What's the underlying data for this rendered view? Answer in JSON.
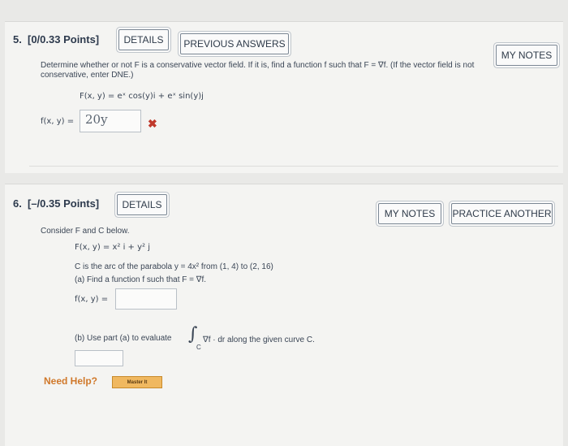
{
  "q5": {
    "number": "5.",
    "points": "[0/0.33 Points]",
    "details_label": "DETAILS",
    "previous_answers_label": "PREVIOUS ANSWERS",
    "my_notes_label": "MY NOTES",
    "prompt_line1": "Determine whether or not F is a conservative vector field. If it is, find a function f such that F = ∇f. (If the vector field is not",
    "prompt_line2": "conservative, enter DNE.)",
    "field": "F(x, y) = eˣ cos(y)i + eˣ sin(y)j",
    "f_label": "f(x, y) =",
    "answer": "20y",
    "incorrect_mark": "✖"
  },
  "q6": {
    "number": "6.",
    "points": "[–/0.35 Points]",
    "details_label": "DETAILS",
    "my_notes_label": "MY NOTES",
    "practice_label": "PRACTICE ANOTHER",
    "consider": "Consider F and C below.",
    "field": "F(x, y) = x² i + y² j",
    "curve": "C is the arc of the parabola  y = 4x²  from (1, 4) to (2, 16)",
    "part_a": "(a) Find a function f such that F = ∇f.",
    "f_label": "f(x, y) =",
    "part_b_prefix": "(b) Use part (a) to evaluate",
    "integral_symbol": "∫",
    "integral_sub": "C",
    "part_b_suffix": "∇f · dr  along the given curve C.",
    "need_help": "Need Help?",
    "master_it": "Master It"
  }
}
